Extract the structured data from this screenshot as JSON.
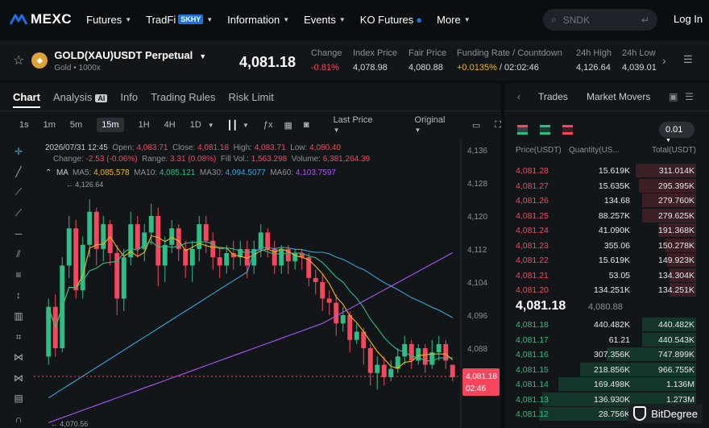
{
  "nav": {
    "logo": "MEXC",
    "items": [
      {
        "label": "Futures",
        "caret": true
      },
      {
        "label": "TradFi",
        "badge": "SKHY",
        "caret": true
      },
      {
        "label": "Information",
        "caret": true
      },
      {
        "label": "Events",
        "caret": true
      },
      {
        "label": "KO Futures",
        "caret": false
      },
      {
        "label": "More",
        "caret": true
      }
    ],
    "search_placeholder": "SNDK",
    "login": "Log In"
  },
  "ticker": {
    "pair": "GOLD(XAU)USDT Perpetual",
    "sub": "Gold • 1000x",
    "last_price": "4,081.18",
    "stats": [
      {
        "label": "Change",
        "value": "-0.81%",
        "color": "red"
      },
      {
        "label": "Index Price",
        "value": "4,078.98",
        "color": ""
      },
      {
        "label": "Fair Price",
        "value": "4,080.88",
        "color": ""
      },
      {
        "label": "Funding Rate / Countdown",
        "value": "+0.0135%",
        "value2": " / 02:02:46",
        "color": "orange"
      },
      {
        "label": "24h High",
        "value": "4,126.64",
        "color": ""
      },
      {
        "label": "24h Low",
        "value": "4,039.01",
        "color": ""
      }
    ]
  },
  "chart_tabs": [
    "Chart",
    "Analysis",
    "Info",
    "Trading Rules",
    "Risk Limit"
  ],
  "analysis_badge": "AI",
  "toolbar": {
    "intervals": [
      "1s",
      "1m",
      "5m",
      "15m",
      "1H",
      "4H",
      "1D"
    ],
    "active_interval": "15m",
    "price_type": "Last Price",
    "view": "Original"
  },
  "legend": {
    "date": "2026/07/31 12:45",
    "open": "4,083.71",
    "close": "4,081.18",
    "high": "4,083.71",
    "low": "4,080.40",
    "change": "-2.53 (-0.06%)",
    "range": "3.31 (0.08%)",
    "fill_vol": "1,563.298",
    "volume": "6,381,264.39",
    "ma5": "4,085.578",
    "ma10": "4,085.121",
    "ma30": "4,094.5077",
    "ma60": "4,103.7597"
  },
  "chart_data": {
    "type": "line",
    "y_ticks": [
      4136,
      4128,
      4120,
      4112,
      4104,
      4096,
      4088
    ],
    "ylim": [
      4068.7,
      4138.5
    ],
    "last_price_label": "4,081.18",
    "countdown_label": "02:46",
    "high_marker": "4,126.64",
    "low_marker": "4,070.56",
    "ohlc": [
      [
        4086,
        4098,
        4084,
        4100
      ],
      [
        4098,
        4088,
        4086,
        4101
      ],
      [
        4088,
        4108,
        4087,
        4110
      ],
      [
        4108,
        4117,
        4105,
        4120
      ],
      [
        4117,
        4102,
        4100,
        4119
      ],
      [
        4102,
        4113,
        4100,
        4115
      ],
      [
        4113,
        4121,
        4110,
        4124
      ],
      [
        4121,
        4112,
        4108,
        4122
      ],
      [
        4112,
        4118,
        4109,
        4120
      ],
      [
        4118,
        4111,
        4108,
        4119
      ],
      [
        4111,
        4100,
        4096,
        4113
      ],
      [
        4100,
        4110,
        4097,
        4112
      ],
      [
        4110,
        4118,
        4108,
        4121
      ],
      [
        4118,
        4112,
        4110,
        4120
      ],
      [
        4112,
        4116,
        4109,
        4118
      ],
      [
        4116,
        4120,
        4113,
        4123
      ],
      [
        4120,
        4108,
        4103,
        4122
      ],
      [
        4108,
        4113,
        4104,
        4115
      ],
      [
        4113,
        4117,
        4111,
        4119
      ],
      [
        4117,
        4112,
        4109,
        4118
      ],
      [
        4112,
        4108,
        4105,
        4114
      ],
      [
        4108,
        4112,
        4104,
        4114
      ],
      [
        4112,
        4118,
        4109,
        4120
      ],
      [
        4118,
        4114,
        4111,
        4120
      ],
      [
        4114,
        4110,
        4107,
        4116
      ],
      [
        4110,
        4108,
        4105,
        4112
      ],
      [
        4108,
        4111,
        4106,
        4113
      ],
      [
        4111,
        4110,
        4107,
        4114
      ],
      [
        4110,
        4112,
        4108,
        4114
      ],
      [
        4112,
        4108,
        4105,
        4114
      ],
      [
        4108,
        4112,
        4106,
        4114
      ],
      [
        4112,
        4116,
        4110,
        4118
      ],
      [
        4116,
        4112,
        4110,
        4117
      ],
      [
        4112,
        4108,
        4106,
        4114
      ],
      [
        4108,
        4112,
        4106,
        4113
      ],
      [
        4112,
        4109,
        4106,
        4113
      ],
      [
        4109,
        4111,
        4107,
        4112
      ],
      [
        4111,
        4110,
        4107,
        4112
      ],
      [
        4110,
        4105,
        4103,
        4111
      ],
      [
        4105,
        4104,
        4101,
        4107
      ],
      [
        4104,
        4100,
        4097,
        4106
      ],
      [
        4100,
        4099,
        4096,
        4102
      ],
      [
        4099,
        4094,
        4091,
        4101
      ],
      [
        4094,
        4096,
        4092,
        4098
      ],
      [
        4096,
        4090,
        4087,
        4097
      ],
      [
        4090,
        4092,
        4089,
        4094
      ],
      [
        4092,
        4088,
        4084,
        4093
      ],
      [
        4088,
        4082,
        4079,
        4089
      ],
      [
        4082,
        4084,
        4078,
        4086
      ],
      [
        4084,
        4081,
        4079,
        4086
      ],
      [
        4081,
        4083,
        4080,
        4085
      ],
      [
        4083,
        4086,
        4082,
        4088
      ],
      [
        4086,
        4089,
        4084,
        4091
      ],
      [
        4089,
        4085,
        4083,
        4090
      ],
      [
        4085,
        4088,
        4084,
        4089
      ],
      [
        4088,
        4084,
        4082,
        4089
      ],
      [
        4084,
        4087,
        4083,
        4090
      ],
      [
        4087,
        4089,
        4085,
        4091
      ],
      [
        4089,
        4085,
        4083,
        4090
      ],
      [
        4084,
        4081,
        4080,
        4084
      ]
    ],
    "ma_colors": {
      "ma5": "#f0b90b",
      "ma10": "#2ebd85",
      "ma30": "#35a6d4",
      "ma60": "#a855f7"
    }
  },
  "orderbook": {
    "tabs": [
      "Trades",
      "Market Movers"
    ],
    "precision": "0.01",
    "headers": [
      "Price(USDT)",
      "Quantity(US...",
      "Total(USDT)"
    ],
    "asks": [
      [
        "4,081.28",
        "15.619K",
        "311.014K",
        0.34
      ],
      [
        "4,081.27",
        "15.635K",
        "295.395K",
        0.32
      ],
      [
        "4,081.26",
        "134.68",
        "279.760K",
        0.3
      ],
      [
        "4,081.25",
        "88.257K",
        "279.625K",
        0.3
      ],
      [
        "4,081.24",
        "41.090K",
        "191.368K",
        0.21
      ],
      [
        "4,081.23",
        "355.06",
        "150.278K",
        0.17
      ],
      [
        "4,081.22",
        "15.619K",
        "149.923K",
        0.16
      ],
      [
        "4,081.21",
        "53.05",
        "134.304K",
        0.15
      ],
      [
        "4,081.20",
        "134.251K",
        "134.251K",
        0.15
      ]
    ],
    "mid_price": "4,081.18",
    "mid_index": "4,080.88",
    "bids": [
      [
        "4,081.18",
        "440.482K",
        "440.482K",
        0.3
      ],
      [
        "4,081.17",
        "61.21",
        "440.543K",
        0.3
      ],
      [
        "4,081.16",
        "307.356K",
        "747.899K",
        0.5
      ],
      [
        "4,081.15",
        "218.856K",
        "966.755K",
        0.65
      ],
      [
        "4,081.14",
        "169.498K",
        "1.136M",
        0.77
      ],
      [
        "4,081.13",
        "136.930K",
        "1.273M",
        0.86
      ],
      [
        "4,081.12",
        "28.756K",
        "1.302M",
        0.88
      ]
    ],
    "watermark": "BitDegree"
  }
}
